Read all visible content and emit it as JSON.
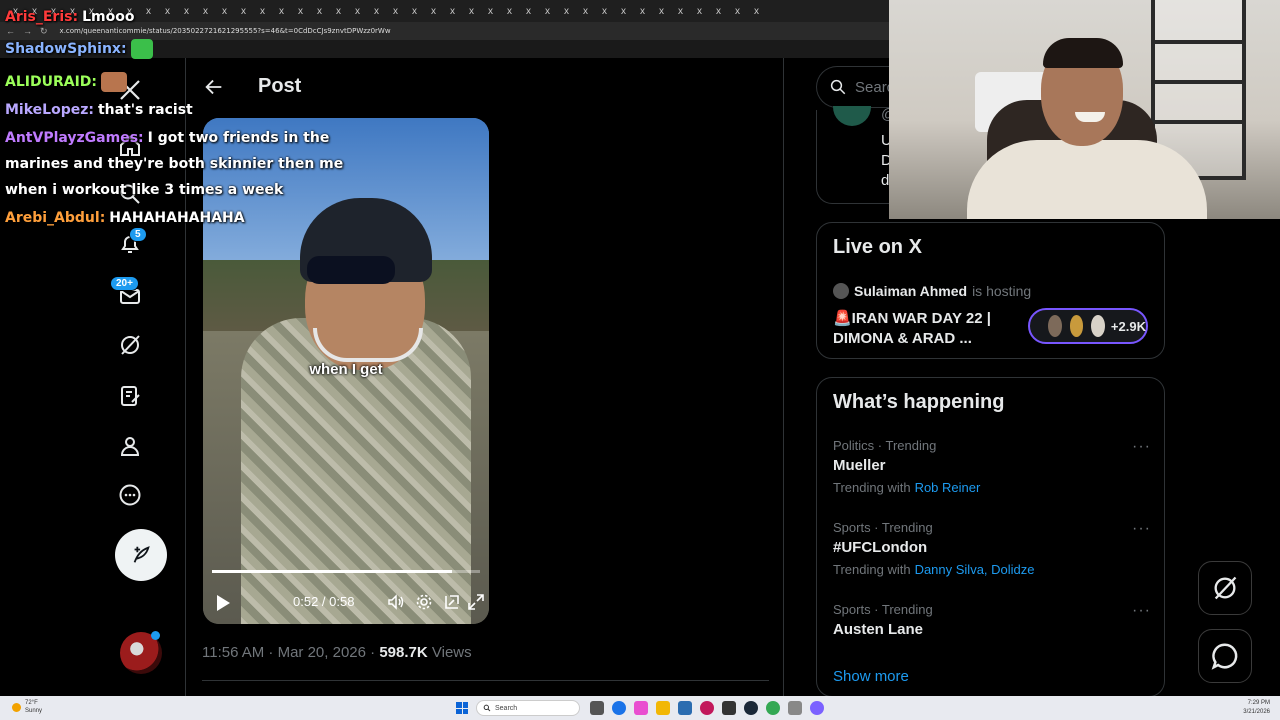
{
  "browser": {
    "url": "x.com/queenanticommie/status/2035022721621295555?s=46&t=0CdDcCJs9znvtDPWzz0rWw",
    "tab_close_glyph": "x",
    "tab_count": 40
  },
  "x_nav": {
    "logo_icon": "x-logo-icon",
    "notifications_badge": "5",
    "messages_badge": "20+",
    "accent": "#1d9bf0"
  },
  "post": {
    "header_title": "Post",
    "video": {
      "caption": "when I get",
      "time": "0:52 / 0:58",
      "progress": 0.897
    },
    "timestamp": "11:56 AM · Mar 20, 2026",
    "separator": "·",
    "views_count": "598.7K",
    "views_label": "Views"
  },
  "sidebar": {
    "search_placeholder": "Search",
    "top_card_lines": [
      "@",
      "U",
      "D",
      "d"
    ],
    "live": {
      "title": "Live on X",
      "host_name": "Sulaiman Ahmed",
      "host_suffix": "is hosting",
      "space_title": "🚨IRAN WAR DAY 22 | DIMONA & ARAD ...",
      "listeners": "+2.9K",
      "pill_color": "#7856ff"
    },
    "happening": {
      "title": "What’s happening",
      "trends": [
        {
          "category": "Politics · Trending",
          "name": "Mueller",
          "with_label": "Trending with",
          "with_links": "Rob Reiner"
        },
        {
          "category": "Sports · Trending",
          "name": "#UFCLondon",
          "with_label": "Trending with",
          "with_links": "Danny Silva, Dolidze"
        },
        {
          "category": "Sports · Trending",
          "name": "Austen Lane",
          "with_label": "",
          "with_links": ""
        }
      ],
      "more_glyph": "···",
      "show_more": "Show more"
    }
  },
  "chat": [
    {
      "user": "Aris_Eris:",
      "text": "Lmooo",
      "color": "#ff3b3b"
    },
    {
      "user": "ShadowSphinx:",
      "text": "",
      "color": "#8ab4ff",
      "emote": "frog-emote"
    },
    {
      "user": "ALIDURAID:",
      "text": "",
      "color": "#9cff5a",
      "emote": "face-emote"
    },
    {
      "user": "MikeLopez:",
      "text": "that's racist",
      "color": "#b9a8ff"
    },
    {
      "user": "AntVPlayzGames:",
      "text": "I got two friends in the",
      "color": "#c07bff"
    },
    {
      "user": "",
      "text": "marines and they're both skinnier then me",
      "color": "#ffffff"
    },
    {
      "user": "",
      "text": "when i workout like 3 times a week",
      "color": "#ffffff"
    },
    {
      "user": "Arebi_Abdul:",
      "text": "HAHAHAHAHAHA",
      "color": "#ff9f3b"
    }
  ],
  "taskbar": {
    "weather_temp": "72°F",
    "weather_desc": "Sunny",
    "search_label": "Search",
    "time": "7:29 PM",
    "date": "3/21/2026"
  }
}
